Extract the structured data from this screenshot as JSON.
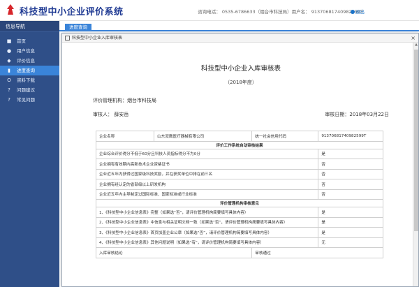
{
  "header": {
    "app_title": "科技型中小企业评价系统",
    "contact": "咨询电话： 0535-6786633（烟台市科技局）用户名： 913706817409825​99T",
    "logout": "退出"
  },
  "sidebar": {
    "title": "信息导航",
    "items": [
      {
        "label": "首页",
        "icon": "home-icon"
      },
      {
        "label": "用户信息",
        "icon": "user-icon"
      },
      {
        "label": "评价信息",
        "icon": "tag-icon"
      },
      {
        "label": "进度查询",
        "icon": "bar-icon"
      },
      {
        "label": "资料下载",
        "icon": "circle-icon"
      },
      {
        "label": "问题建议",
        "icon": "help-icon"
      },
      {
        "label": "常见问题",
        "icon": "faq-icon"
      }
    ]
  },
  "main": {
    "tab": "进度查询"
  },
  "modal": {
    "title": "科技型中小企业入库审核表",
    "doc_title": "科技型中小企业入库审核表",
    "year": "（2018年度）",
    "org_label": "评价管理机构：",
    "org_value": "烟台市科技局",
    "reviewer_label": "审核人：",
    "reviewer_value": "薛安岳",
    "date_label": "审核日期：",
    "date_value": "2018年03月22日",
    "company_label": "企业名称",
    "company_value": "山东双鹰医疗器械有限公司",
    "credit_label": "统一社会信用代码",
    "credit_value": "913706817409825​99T",
    "sec1": "评价工作系统自动审核结果",
    "rows1": [
      {
        "q": "企业综合评价得分不低于60分且科技人员指标得分不为0分",
        "a": "是"
      },
      {
        "q": "企业拥有有效期内高新技术企业资格证书",
        "a": "否"
      },
      {
        "q": "企业近五年内获得过国家级科技奖励，并在获奖单位中排在前三名",
        "a": "否"
      },
      {
        "q": "企业拥有经认定的省部级以上研发机构",
        "a": "否"
      },
      {
        "q": "企业近五年内主导制定过国际标准、国家标准或行业标准",
        "a": "否"
      }
    ],
    "sec2": "评价管理机构审核意见",
    "rows2": [
      {
        "q": "1、《科技型中小企业信息表》完整（如果选“否”，请评价管理机构简要填写具体内容）",
        "a": "是"
      },
      {
        "q": "2、《科技型中小企业信息表》中信息与相关证明文档一致（如果选“否”，请评价管理机构简要填写具体内容）",
        "a": "是"
      },
      {
        "q": "3、《科技型中小企业信息表》首页加盖企业公章（如果选“否”，请评价管理机构简要填写具体内容）",
        "a": "是"
      },
      {
        "q": "4、《科技型中小企业信息表》其他问题说明（如果选“有”，请评价管理机构简要填写具体内容）",
        "a": "无"
      }
    ],
    "final_label": "入库审核结论",
    "final_value": "审核通过"
  }
}
